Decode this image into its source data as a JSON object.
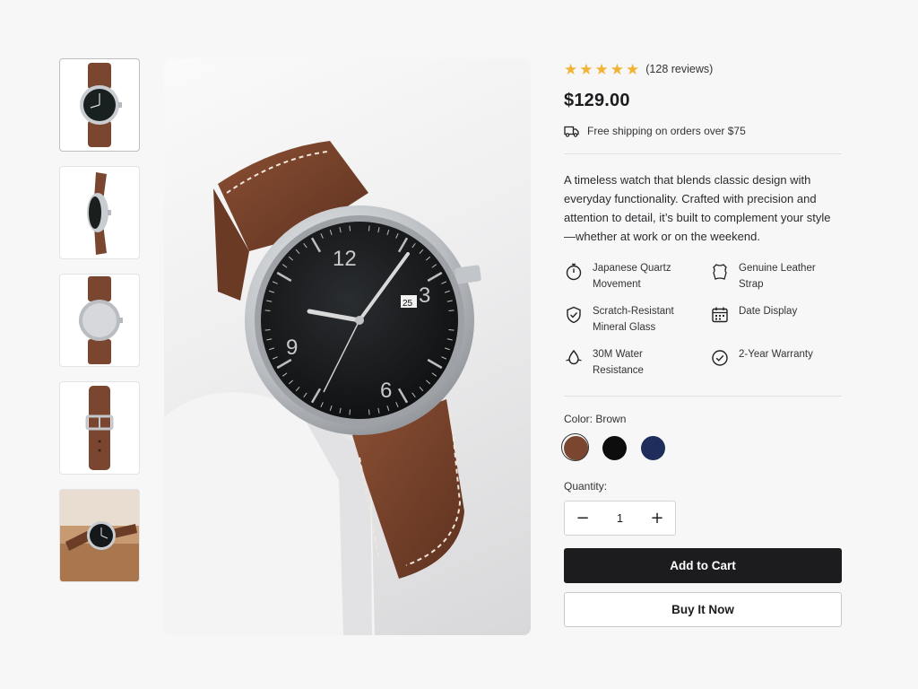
{
  "product": {
    "rating_stars": 5,
    "reviews": "(128 reviews)",
    "price": "$129.00",
    "shipping": "Free shipping on orders over $75",
    "description": "A timeless watch that blends classic design with everyday functionality. Crafted with precision and attention to detail, it’s built to complement your style—whether at work or on the weekend."
  },
  "features": [
    {
      "icon": "stopwatch-icon",
      "label": "Japanese Quartz Movement"
    },
    {
      "icon": "leather-hide-icon",
      "label": "Genuine Leather Strap"
    },
    {
      "icon": "shield-check-icon",
      "label": "Scratch-Resistant Mineral Glass"
    },
    {
      "icon": "calendar-icon",
      "label": "Date Display"
    },
    {
      "icon": "water-drop-icon",
      "label": "30M Water Resistance"
    },
    {
      "icon": "check-circle-icon",
      "label": "2-Year Warranty"
    }
  ],
  "color": {
    "label": "Color:",
    "selected": "Brown",
    "options": [
      {
        "name": "Brown",
        "hex": "#7a4630"
      },
      {
        "name": "Black",
        "hex": "#0d0d0d"
      },
      {
        "name": "Navy",
        "hex": "#1f2d5c"
      }
    ]
  },
  "quantity": {
    "label": "Quantity:",
    "value": "1",
    "decrement": "−",
    "increment": "+"
  },
  "buttons": {
    "add_to_cart": "Add to Cart",
    "buy_now": "Buy It Now"
  },
  "thumbnails": [
    "watch-front",
    "watch-side",
    "watch-back",
    "strap-buckle",
    "watch-lifestyle"
  ],
  "hero_dial_numerals": [
    "12",
    "3",
    "6",
    "9"
  ],
  "hero_date": "25",
  "colors": {
    "accent": "#1c1c1e",
    "star": "#f2b233",
    "strap": "#7a4630"
  }
}
